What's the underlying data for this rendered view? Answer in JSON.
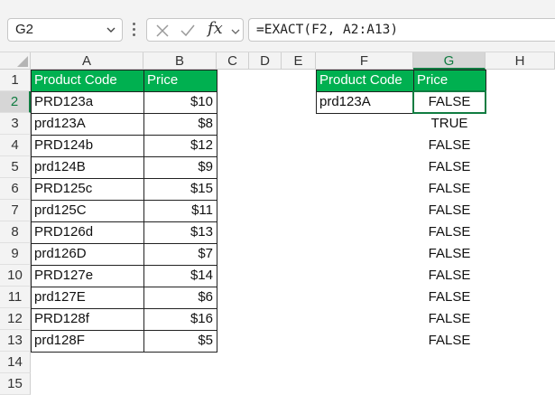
{
  "formula_bar": {
    "name_box": "G2",
    "fx_label": "fx",
    "formula": "=EXACT(F2, A2:A13)"
  },
  "columns": [
    "A",
    "B",
    "C",
    "D",
    "E",
    "F",
    "G",
    "H"
  ],
  "rows": [
    "1",
    "2",
    "3",
    "4",
    "5",
    "6",
    "7",
    "8",
    "9",
    "10",
    "11",
    "12",
    "13",
    "14",
    "15"
  ],
  "active_cell": "G2",
  "table1": {
    "headers": [
      "Product Code",
      "Price"
    ],
    "rows": [
      [
        "PRD123a",
        "$10"
      ],
      [
        "prd123A",
        "$8"
      ],
      [
        "PRD124b",
        "$12"
      ],
      [
        "prd124B",
        "$9"
      ],
      [
        "PRD125c",
        "$15"
      ],
      [
        "prd125C",
        "$11"
      ],
      [
        "PRD126d",
        "$13"
      ],
      [
        "prd126D",
        "$7"
      ],
      [
        "PRD127e",
        "$14"
      ],
      [
        "prd127E",
        "$6"
      ],
      [
        "PRD128f",
        "$16"
      ],
      [
        "prd128F",
        "$5"
      ]
    ]
  },
  "table2": {
    "headers": [
      "Product Code",
      "Price"
    ],
    "lookup_value": "prd123A"
  },
  "results": [
    "FALSE",
    "TRUE",
    "FALSE",
    "FALSE",
    "FALSE",
    "FALSE",
    "FALSE",
    "FALSE",
    "FALSE",
    "FALSE",
    "FALSE",
    "FALSE"
  ],
  "colors": {
    "header_fill": "#00b050",
    "header_text": "#ffffff",
    "selection": "#107c41"
  }
}
